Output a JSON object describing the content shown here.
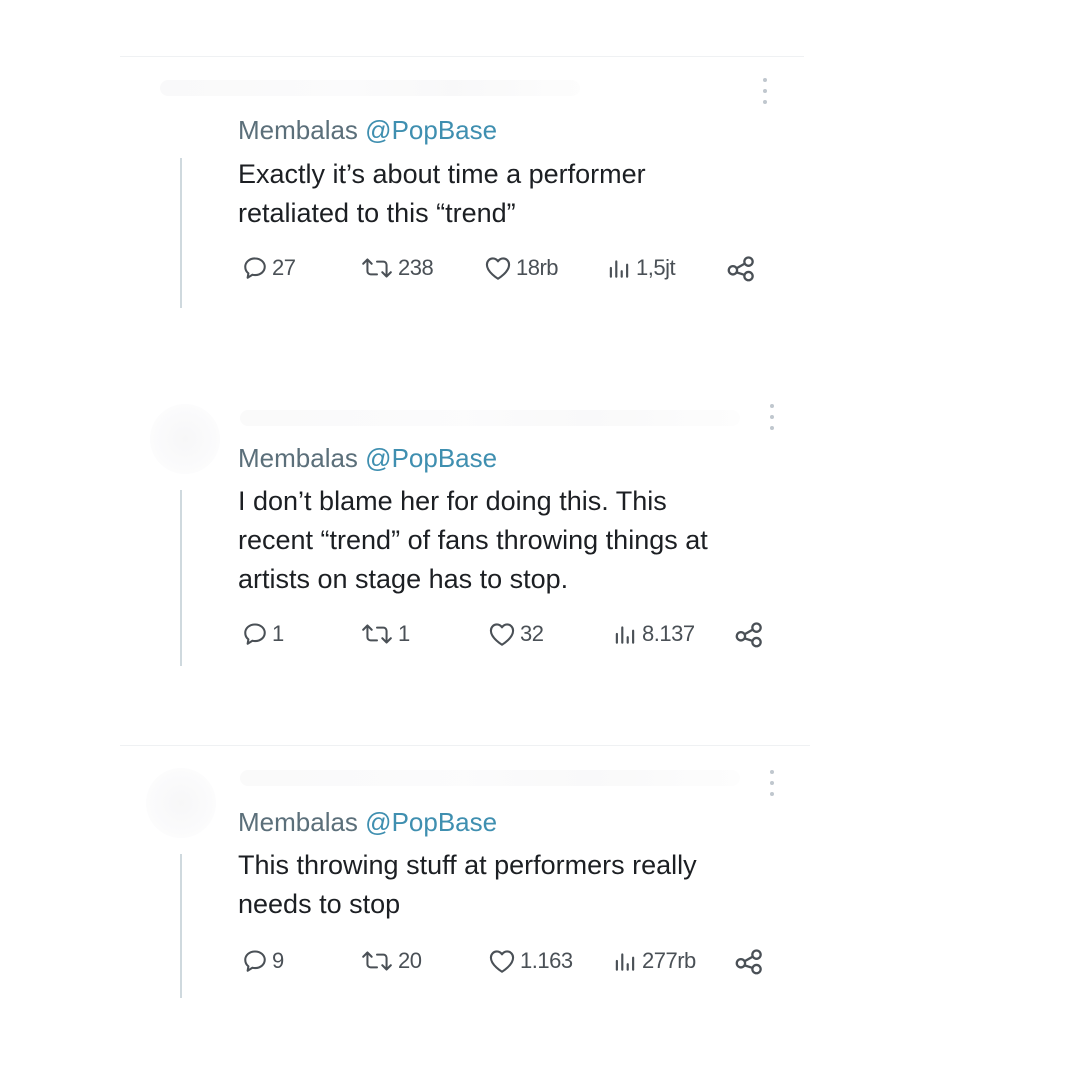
{
  "tweets": [
    {
      "replying_to_label": "Membalas",
      "replying_to_handle": "@PopBase",
      "text_lines": [
        "Exactly it’s about time a performer",
        "retaliated to this “trend”"
      ],
      "stats": {
        "replies": "27",
        "reposts": "238",
        "likes": "18rb",
        "views": "1,5jt"
      }
    },
    {
      "replying_to_label": "Membalas",
      "replying_to_handle": "@PopBase",
      "text_lines": [
        "I don’t blame her for doing this. This",
        "recent “trend” of fans throwing things at",
        "artists on stage has to stop."
      ],
      "stats": {
        "replies": "1",
        "reposts": "1",
        "likes": "32",
        "views": "8.137"
      }
    },
    {
      "replying_to_label": "Membalas",
      "replying_to_handle": "@PopBase",
      "text_lines": [
        "This throwing stuff at performers really",
        "needs to stop"
      ],
      "stats": {
        "replies": "9",
        "reposts": "20",
        "likes": "1.163",
        "views": "277rb"
      }
    }
  ],
  "icons": {
    "reply": "reply-icon",
    "repost": "repost-icon",
    "like": "heart-icon",
    "views": "views-icon",
    "share": "share-icon",
    "more": "more-icon"
  },
  "colors": {
    "text": "#1c1f23",
    "meta": "#5b6f7a",
    "handle": "#3f8fb0",
    "icon": "#4a5056",
    "thread_line": "#cfd9de"
  }
}
